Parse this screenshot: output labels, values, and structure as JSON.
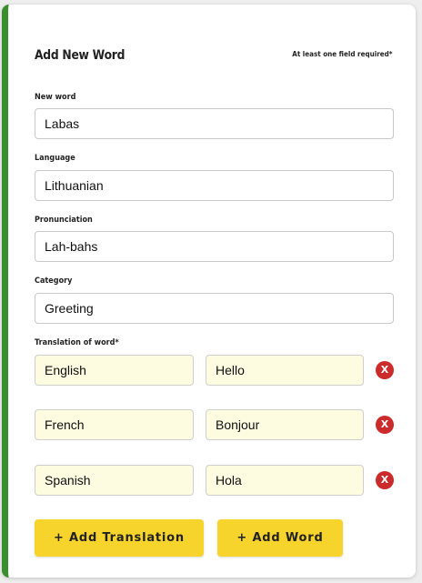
{
  "form": {
    "title": "Add New Word",
    "hint": "At least one field required*"
  },
  "fields": {
    "new_word": {
      "label": "New word",
      "value": "Labas"
    },
    "language": {
      "label": "Language",
      "value": "Lithuanian"
    },
    "pronunciation": {
      "label": "Pronunciation",
      "value": "Lah-bahs"
    },
    "category": {
      "label": "Category",
      "value": "Greeting"
    }
  },
  "translations": {
    "label": "Translation of word*",
    "rows": [
      {
        "language": "English",
        "value": "Hello",
        "remove_icon": "X"
      },
      {
        "language": "French",
        "value": "Bonjour",
        "remove_icon": "X"
      },
      {
        "language": "Spanish",
        "value": "Hola",
        "remove_icon": "X"
      }
    ]
  },
  "buttons": {
    "add_translation": "+ Add Translation",
    "add_word": "+ Add Word"
  },
  "colors": {
    "accent_green": "#3a8f2d",
    "button_yellow": "#f7d42b",
    "translation_field_bg": "#fdfbe0",
    "remove_red": "#cc2b2b"
  }
}
